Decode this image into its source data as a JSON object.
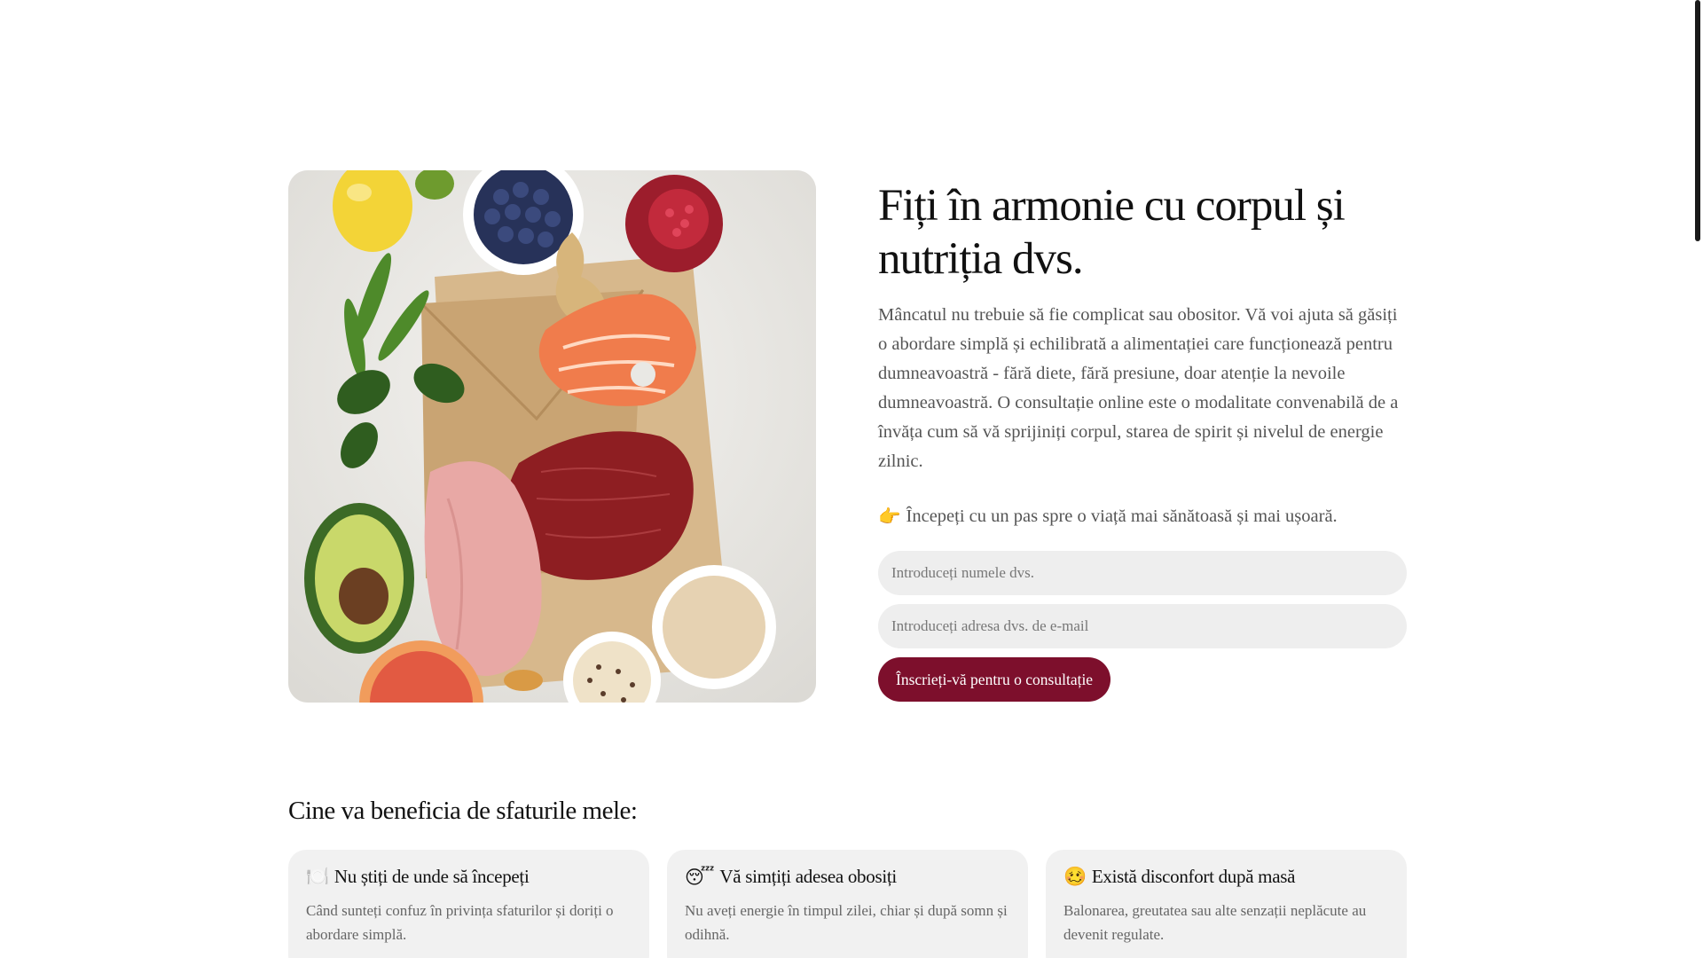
{
  "hero": {
    "image_alt": "healthy-food-photo",
    "title": "Fiți în armonie cu corpul și nutriția dvs.",
    "description": "Mâncatul nu trebuie să fie complicat sau obositor. Vă voi ajuta să găsiți o abordare simplă și echilibrată a alimentației care funcționează pentru dumneavoastră - fără diete, fără presiune, doar atenție la nevoile dumneavoastră. O consultație online este o modalitate convenabilă de a învăța cum să vă sprijiniți corpul, starea de spirit și nivelul de energie zilnic.",
    "cta_emoji": "👉",
    "cta_text": "Începeți cu un pas spre o viață mai sănătoasă și mai ușoară.",
    "form": {
      "name_placeholder": "Introduceți numele dvs.",
      "email_placeholder": "Introduceți adresa dvs. de e-mail",
      "submit_label": "Înscrieți-vă pentru o consultație"
    }
  },
  "benefits": {
    "title": "Cine va beneficia de sfaturile mele:",
    "cards": [
      {
        "icon": "plate-icon",
        "emoji": "🍽️",
        "title": "Nu știți de unde să începeți",
        "description": "Când sunteți confuz în privința sfaturilor și doriți o abordare simplă."
      },
      {
        "icon": "sleepy-face-icon",
        "emoji": "😴",
        "title": "Vă simțiți adesea obosiți",
        "description": "Nu aveți energie în timpul zilei, chiar și după somn și odihnă."
      },
      {
        "icon": "woozy-face-icon",
        "emoji": "🥴",
        "title": "Există disconfort după masă",
        "description": "Balonarea, greutatea sau alte senzații neplăcute au devenit regulate."
      }
    ]
  },
  "colors": {
    "accent": "#7d0f2c",
    "input_bg": "#eeeeee",
    "card_bg": "#f1f1f1"
  }
}
